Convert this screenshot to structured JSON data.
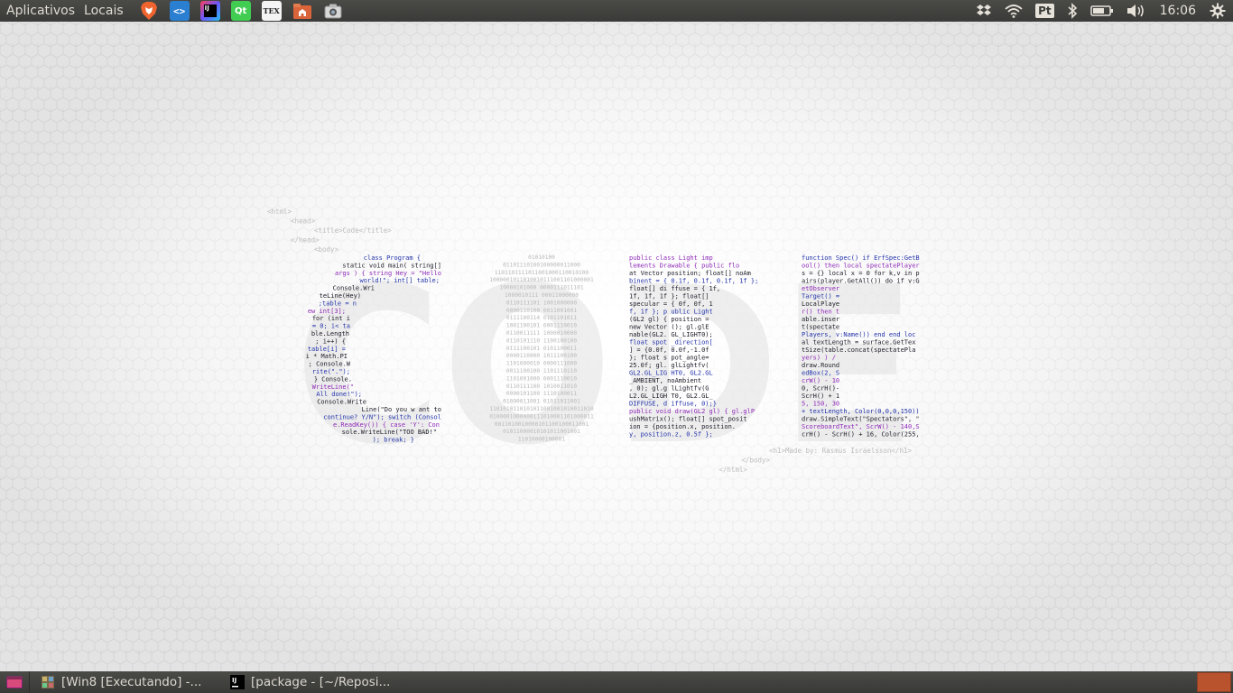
{
  "top_panel": {
    "menus": [
      {
        "label": "Aplicativos"
      },
      {
        "label": "Locais"
      }
    ],
    "launchers": [
      {
        "icon": "brave-browser-icon",
        "color": "#f0652f"
      },
      {
        "icon": "vscode-editor-icon",
        "color": "#2b7fd1",
        "glyph": "<>"
      },
      {
        "icon": "intellij-idea-icon",
        "color": "#1f2b6b",
        "glyph": "IJ"
      },
      {
        "icon": "qt-creator-icon",
        "color": "#41cd52",
        "glyph": "Qt"
      },
      {
        "icon": "texmaker-icon",
        "color": "#ffffff",
        "glyph": "TEX"
      },
      {
        "icon": "home-folder-icon",
        "color": "#d9643a"
      },
      {
        "icon": "screenshot-camera-icon",
        "color": "#d8d8d8"
      }
    ],
    "tray": {
      "keyboard_layout": "Pt",
      "clock": "16:06"
    }
  },
  "wallpaper": {
    "word": "CODE",
    "accent_blue": "#2233aa",
    "accent_purple": "#8e2ab8",
    "html_top": [
      "<html>",
      "<head>",
      "<title>Code</title>",
      "</head>",
      "<body>"
    ],
    "html_bottom": [
      "<h1>Made by: Rasmus Israelsson</h1>",
      "</body>",
      "</html>"
    ],
    "c_letter_lines": [
      "class Program {",
      "static void main( string[]",
      "args ) { string Hey = \"Hello",
      "world!\"; int[]            table;",
      "Console.Wri",
      "teLine(Hey)",
      ";table = n",
      "ew int[3];",
      "for (int i",
      "= 0; i< ta",
      "ble.Length",
      "; i++) {",
      "table[i] =",
      "i * Math.PI",
      "; Console.W",
      "rite(\".\");",
      "} Console.",
      "WriteLine(\"",
      "All done!\");",
      "Console.Write",
      "Line(\"Do you w           ant to",
      "continue? Y/N\"); switch (Consol",
      "e.ReadKey()) { case 'Y': Con",
      "sole.WriteLine(\"TOO BAD!\"",
      "); break; }"
    ],
    "o_letter_lines": [
      "01010100",
      "01101110100100000011000",
      "1101101111011001000110010100",
      "1000001011010010111001101000001",
      "10000101000        0000111011101",
      "1000010111           00011000000",
      "0110111101           1001000000",
      "0000110100            0011001001",
      "0111100114            0101101011",
      "1001100101            0001110010",
      "0110011111            1000010000",
      "0110101110            1100100100",
      "0111100101            0101100011",
      "0000110000            1011100100",
      "1101000010            0000111000",
      "0011100100            1101110110",
      "1101001000            0001110010",
      "0110111100            1010011010",
      "0000101100           1110100011",
      "01000011001         01011011001",
      "1101010110101011001001010011010",
      "0100001000000111010001101000011",
      "0011010010000101100100011001",
      "01011000010101011001001",
      "11010000100001"
    ],
    "d_letter_lines": [
      "public class Light imp",
      "lements Drawable { public flo",
      "at Vector position; float[] noAm",
      "binent = { 0.1f, 0.1f, 0.1f, 1f };",
      "float[] di            ffuse = { 1f,",
      "1f, 1f, 1f             }; float[]",
      "specular =               { 0f, 0f, 1",
      "f, 1f }; p               ublic Light",
      "(GL2 gl) {                position =",
      "new Vector                (); gl.glE",
      "nable(GL2.                GL_LIGHT0);",
      "float spot                _direction[",
      "] = {0.0f,                0.0f,-1.0f",
      "}; float s                pot_angle=",
      "25.0f; gl.               glLightfv(",
      "GL2.GL_LIG              HT0, GL2.GL",
      "_AMBIENT,              noAmbient",
      ", 0); gl.g           lLightfv(G",
      "L2.GL_LIGH         T0, GL2.GL_",
      "DIFFUSE, d       iffuse, 0);}",
      "public void draw(GL2 gl) { gl.glP",
      "ushMatrix(); float[] spot_posit",
      "ion = {position.x, position.",
      "y, position.z, 0.5f };"
    ],
    "e_letter_lines": [
      "function Spec() if ErfSpec:GetB",
      "ool() then local spectatePlayer",
      "s = {} local x = 0 for k,v in p",
      "airs(player.GetAll()) do if v:G",
      "etObserver",
      "Target() =",
      "LocalPlaye",
      "r() then t",
      "able.inser",
      "t(spectate",
      "Players, v:Name()) end end loc",
      "al textLength = surface.GetTex",
      "tSize(table.concat(spectatePla",
      "yers) ) /",
      "draw.Round",
      "edBox(2, S",
      "crW() - 10",
      "0, ScrH()-",
      "ScrH() + 1",
      "5, 150, 30",
      "+ textLength, Color(0,0,0,150))",
      "draw.SimpleText(\"Spectators\", \"",
      "ScoreboardText\", ScrW() - 140,S",
      "crH() - ScrH() + 16, Color(255,"
    ]
  },
  "bottom_panel": {
    "tasks": [
      {
        "label": "[Win8 [Executando] -...",
        "icon": "virtualbox-icon"
      },
      {
        "label": "[package - [~/Reposi...",
        "icon": "intellij-idea-icon"
      }
    ],
    "workspace_color": "#b8532e"
  }
}
